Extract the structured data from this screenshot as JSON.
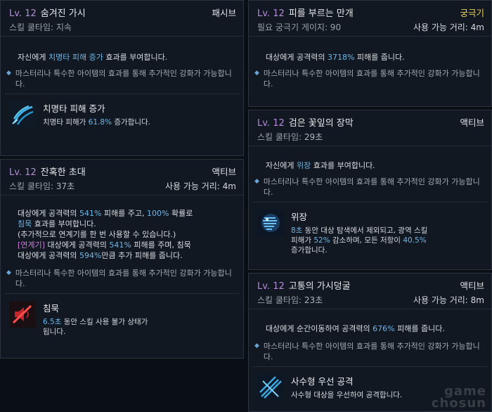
{
  "cards": {
    "hidden_thorn": {
      "level": "Lv. 12",
      "title": "숨겨진 가시",
      "type": "패시브",
      "cooldown": "스킬 쿨타임: 지속",
      "desc_pre": "자신에게 ",
      "desc_hl": "치명타 피해 증가",
      "desc_post": " 효과를 부여합니다.",
      "mastery": "마스터리나 특수한 아이템의 효과를 통해 추가적인 강화가 가능합니다.",
      "buff_name": "치명타 피해 증가",
      "buff_pre": "치명타 피해가 ",
      "buff_val": "61.8%",
      "buff_post": " 증가합니다.",
      "icon": "crit-damage-icon"
    },
    "cruel_invite": {
      "level": "Lv. 12",
      "title": "잔혹한 초대",
      "type": "액티브",
      "cooldown_label": "스킬 쿨타임: ",
      "cooldown_val": "37초",
      "range": "사용 가능 거리: 4m",
      "l1_pre": "대상에게 공격력의 ",
      "l1_v1": "541%",
      "l1_mid": " 피해를 주고, ",
      "l1_v2": "100%",
      "l1_post": " 확률로",
      "l2_hl": "침묵",
      "l2_post": " 효과를 부여합니다.",
      "l3": "(추가적으로 연계기를 한 번 사용할 수 있습니다.)",
      "l4_tag": "[연계기]",
      "l4_pre": " 대상에게 공격력의 ",
      "l4_val": "541%",
      "l4_post": " 피해를 주며, 침묵",
      "l5_pre": "대상에게 공격력의 ",
      "l5_val": "594%",
      "l5_post": "만큼 추가 피해를 줍니다.",
      "mastery": "마스터리나 특수한 아이템의 효과를 통해 추가적인 강화가 가능합니다.",
      "buff_name": "침묵",
      "buff_val": "6.5초",
      "buff_post1": " 동안 스킬 사용 불가 상태가",
      "buff_post2": "됩니다.",
      "icon": "silence-icon"
    },
    "blood_bloom": {
      "level": "Lv. 12",
      "title": "피를 부르는 만개",
      "type": "궁극기",
      "cost": "필요 궁극기 게이지: 90",
      "range": "사용 가능 거리: 4m",
      "desc_pre": "대상에게 공격력의 ",
      "desc_val": "3718%",
      "desc_post": " 피해를 줍니다.",
      "mastery": "마스터리나 특수한 아이템의 효과를 통해 추가적인 강화가 가능합니다."
    },
    "black_curtain": {
      "level": "Lv. 12",
      "title": "검은 꽃잎의 장막",
      "type": "액티브",
      "cooldown_label": "스킬 쿨타임: ",
      "cooldown_val": "29초",
      "desc_pre": "자신에게 ",
      "desc_hl": "위장",
      "desc_post": " 효과를 부여합니다.",
      "mastery": "마스터리나 특수한 아이템의 효과를 통해 추가적인 강화가 가능합니다.",
      "buff_name": "위장",
      "b1_val": "8초",
      "b1_post": " 동안 대상 탐색에서 제외되고, 광역 스킬",
      "b2_pre": "피해가 ",
      "b2_val": "52%",
      "b2_mid": " 감소하며, 모든 저항이 ",
      "b2_val2": "40.5%",
      "b3": "증가합니다.",
      "icon": "camouflage-icon"
    },
    "pain_vine": {
      "level": "Lv. 12",
      "title": "고통의 가시덩굴",
      "type": "액티브",
      "cooldown_label": "스킬 쿨타임: ",
      "cooldown_val": "23초",
      "range": "사용 가능 거리: 8m",
      "desc_pre": "대상에게 순간이동하여 공격력의 ",
      "desc_val": "676%",
      "desc_post": " 피해를 줍니다.",
      "mastery": "마스터리나 특수한 아이템의 효과를 통해 추가적인 강화가 가능합니다.",
      "buff_name": "사수형 우선 공격",
      "buff_desc": "사수형 대상을 우선하여 공격합니다.",
      "icon": "ranged-priority-icon"
    }
  },
  "watermark": {
    "line1": "game",
    "line2": "chosun"
  }
}
